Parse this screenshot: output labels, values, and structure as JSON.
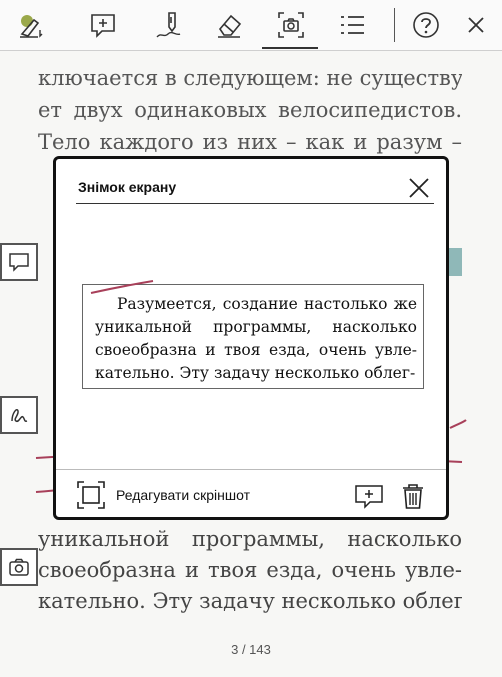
{
  "toolbar": {
    "icons": [
      "highlighter-icon",
      "add-note-icon",
      "pen-icon",
      "eraser-icon",
      "screenshot-icon",
      "list-icon",
      "help-icon",
      "close-icon"
    ]
  },
  "book": {
    "top_lines": [
      "ключается в следующем: не существу-",
      "ет двух одинаковых велосипедистов.",
      "Тело каждого из них – как и разум –"
    ],
    "bottom_lines": [
      "уникальной программы, насколько",
      "своеобразна и твоя езда, очень увле-",
      "кательно. Эту задачу несколько облег-"
    ]
  },
  "page_indicator": "3 / 143",
  "dialog": {
    "title": "Знімок екрану",
    "screenshot_lines": [
      "Разумеется, создание настолько же",
      "уникальной программы, насколько",
      "своеобразна и твоя езда, очень увле-",
      "кательно. Эту задачу несколько облег-"
    ],
    "edit_label": "Редагувати скріншот"
  },
  "colors": {
    "highlight": "#8fb8b8",
    "pen_stroke": "#a8405a"
  }
}
